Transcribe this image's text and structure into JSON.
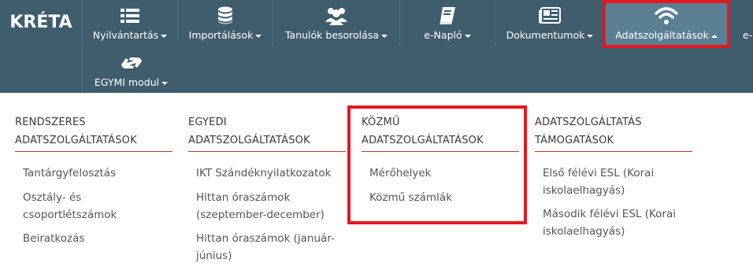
{
  "brand": {
    "logo_text": "KRÉTA"
  },
  "nav": {
    "items": [
      {
        "label": "Nyilvántartás",
        "icon": "list-icon"
      },
      {
        "label": "Importálások",
        "icon": "database-icon"
      },
      {
        "label": "Tanulók besorolása",
        "icon": "users-icon"
      },
      {
        "label": "e-Napló",
        "icon": "book-icon"
      },
      {
        "label": "Dokumentumok",
        "icon": "newspaper-icon"
      },
      {
        "label": "Adatszolgáltatások",
        "icon": "wifi-icon"
      },
      {
        "label": "e-",
        "icon": ""
      },
      {
        "label": "EGYMI modul",
        "icon": "sign-language-icon"
      }
    ],
    "active_item": "Adatszolgáltatások"
  },
  "dropdown": {
    "columns": [
      {
        "heading_line1": "RENDSZERES",
        "heading_line2": "ADATSZOLGÁLTATÁSOK",
        "links": [
          [
            "Tantárgyfelosztás"
          ],
          [
            "Osztály- és",
            "csoportlétszámok"
          ],
          [
            "Beiratkozás"
          ]
        ]
      },
      {
        "heading_line1": "EGYEDI",
        "heading_line2": "ADATSZOLGÁLTATÁSOK",
        "links": [
          [
            "IKT Szándéknyilatkozatok"
          ],
          [
            "Hittan óraszámok",
            "(szeptember-december)"
          ],
          [
            "Hittan óraszámok (január-",
            "június)"
          ]
        ]
      },
      {
        "heading_line1": "KÖZMŰ",
        "heading_line2": "ADATSZOLGÁLTATÁSOK",
        "links": [
          [
            "Mérőhelyek"
          ],
          [
            "Közmű számlák"
          ]
        ]
      },
      {
        "heading_line1": "ADATSZOLGÁLTATÁS",
        "heading_line2": "TÁMOGATÁSOK",
        "links": [
          [
            "Első félévi ESL (Korai",
            "iskolaelhagyás)"
          ],
          [
            "Második félévi ESL (Korai",
            "iskolaelhagyás)"
          ]
        ]
      }
    ]
  },
  "colors": {
    "navbar": "#3f5d6d",
    "active": "#5a7f92",
    "highlight": "#e8161e",
    "rule": "#c0392b"
  }
}
